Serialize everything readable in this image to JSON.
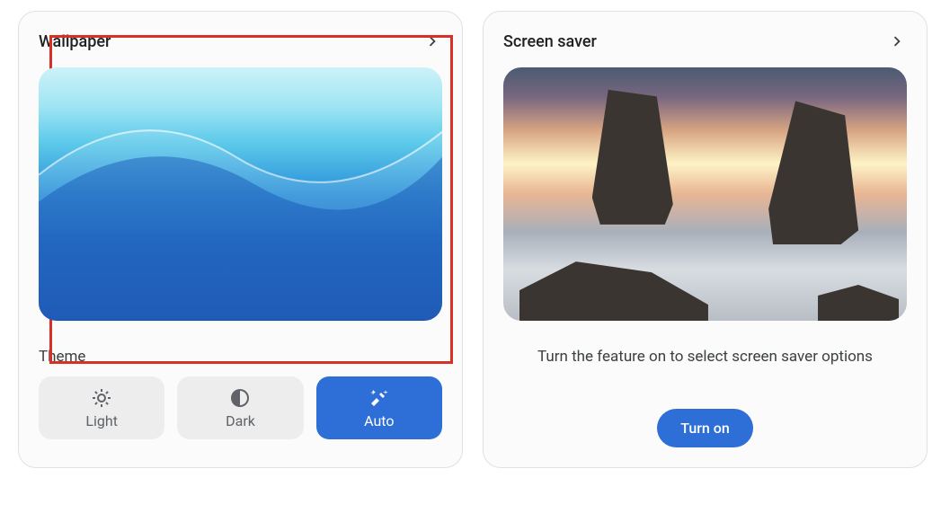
{
  "wallpaper": {
    "title": "Wallpaper",
    "theme_section": "Theme",
    "themes": {
      "light": "Light",
      "dark": "Dark",
      "auto": "Auto"
    },
    "highlighted": true
  },
  "screensaver": {
    "title": "Screen saver",
    "helper": "Turn the feature on to select screen saver options",
    "action": "Turn on"
  }
}
